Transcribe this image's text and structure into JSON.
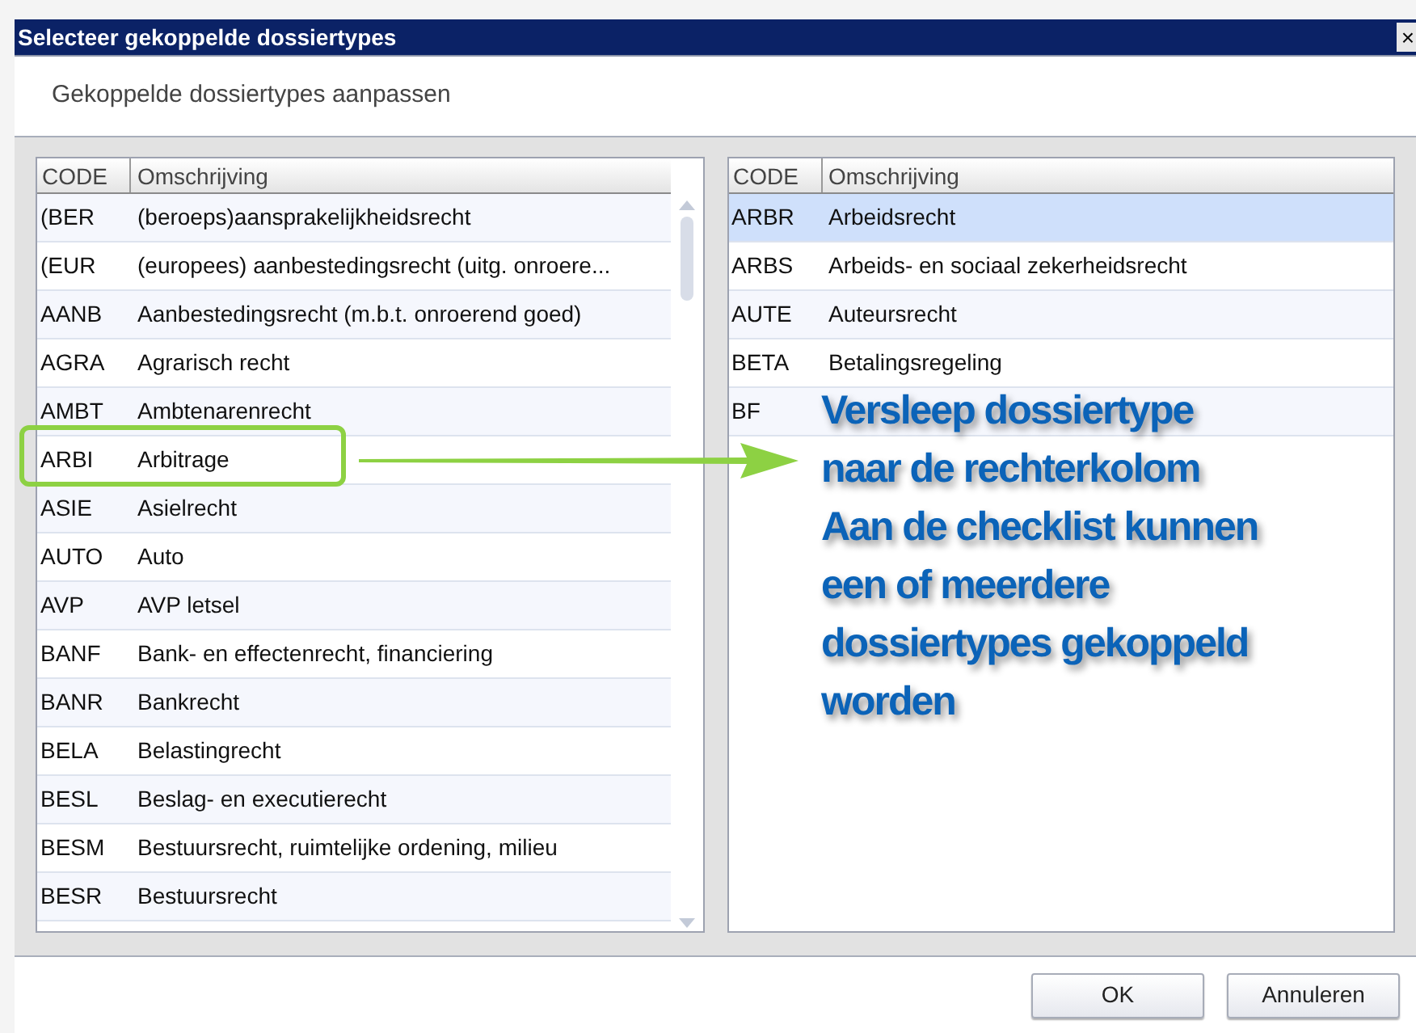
{
  "window": {
    "title": "Selecteer gekoppelde dossiertypes",
    "close": "×"
  },
  "heading": "Gekoppelde dossiertypes aanpassen",
  "available": {
    "columns": [
      "CODE",
      "Omschrijving"
    ],
    "rows": [
      {
        "code": "(BER",
        "description": "(beroeps)aansprakelijkheidsrecht",
        "callout": false
      },
      {
        "code": "(EUR",
        "description": "(europees) aanbestedingsrecht (uitg. onroere...",
        "callout": false
      },
      {
        "code": "AANB",
        "description": "Aanbestedingsrecht (m.b.t. onroerend goed)",
        "callout": false
      },
      {
        "code": "AGRA",
        "description": "Agrarisch recht",
        "callout": false
      },
      {
        "code": "AMBT",
        "description": "Ambtenarenrecht",
        "callout": false
      },
      {
        "code": "ARBI",
        "description": "Arbitrage",
        "callout": true
      },
      {
        "code": "ASIE",
        "description": "Asielrecht",
        "callout": false
      },
      {
        "code": "AUTO",
        "description": "Auto",
        "callout": false
      },
      {
        "code": "AVP",
        "description": "AVP letsel",
        "callout": false
      },
      {
        "code": "BANF",
        "description": "Bank- en effectenrecht, financiering",
        "callout": false
      },
      {
        "code": "BANR",
        "description": "Bankrecht",
        "callout": false
      },
      {
        "code": "BELA",
        "description": "Belastingrecht",
        "callout": false
      },
      {
        "code": "BESL",
        "description": "Beslag- en executierecht",
        "callout": false
      },
      {
        "code": "BESM",
        "description": "Bestuursrecht, ruimtelijke ordening, milieu",
        "callout": false
      },
      {
        "code": "BESR",
        "description": "Bestuursrecht",
        "callout": false
      }
    ]
  },
  "linked": {
    "columns": [
      "CODE",
      "Omschrijving"
    ],
    "rows": [
      {
        "code": "ARBR",
        "description": "Arbeidsrecht",
        "selected": true
      },
      {
        "code": "ARBS",
        "description": "Arbeids- en sociaal zekerheidsrecht",
        "selected": false
      },
      {
        "code": "AUTE",
        "description": "Auteursrecht",
        "selected": false
      },
      {
        "code": "BETA",
        "description": "Betalingsregeling",
        "selected": false
      },
      {
        "code": "BF",
        "selected": false
      }
    ]
  },
  "annotation": [
    "Versleep dossiertype",
    "naar de rechterkolom",
    "Aan de checklist kunnen",
    "een of meerdere",
    "dossiertypes gekoppeld",
    "worden"
  ],
  "buttons": [
    "OK",
    "Annuleren"
  ]
}
